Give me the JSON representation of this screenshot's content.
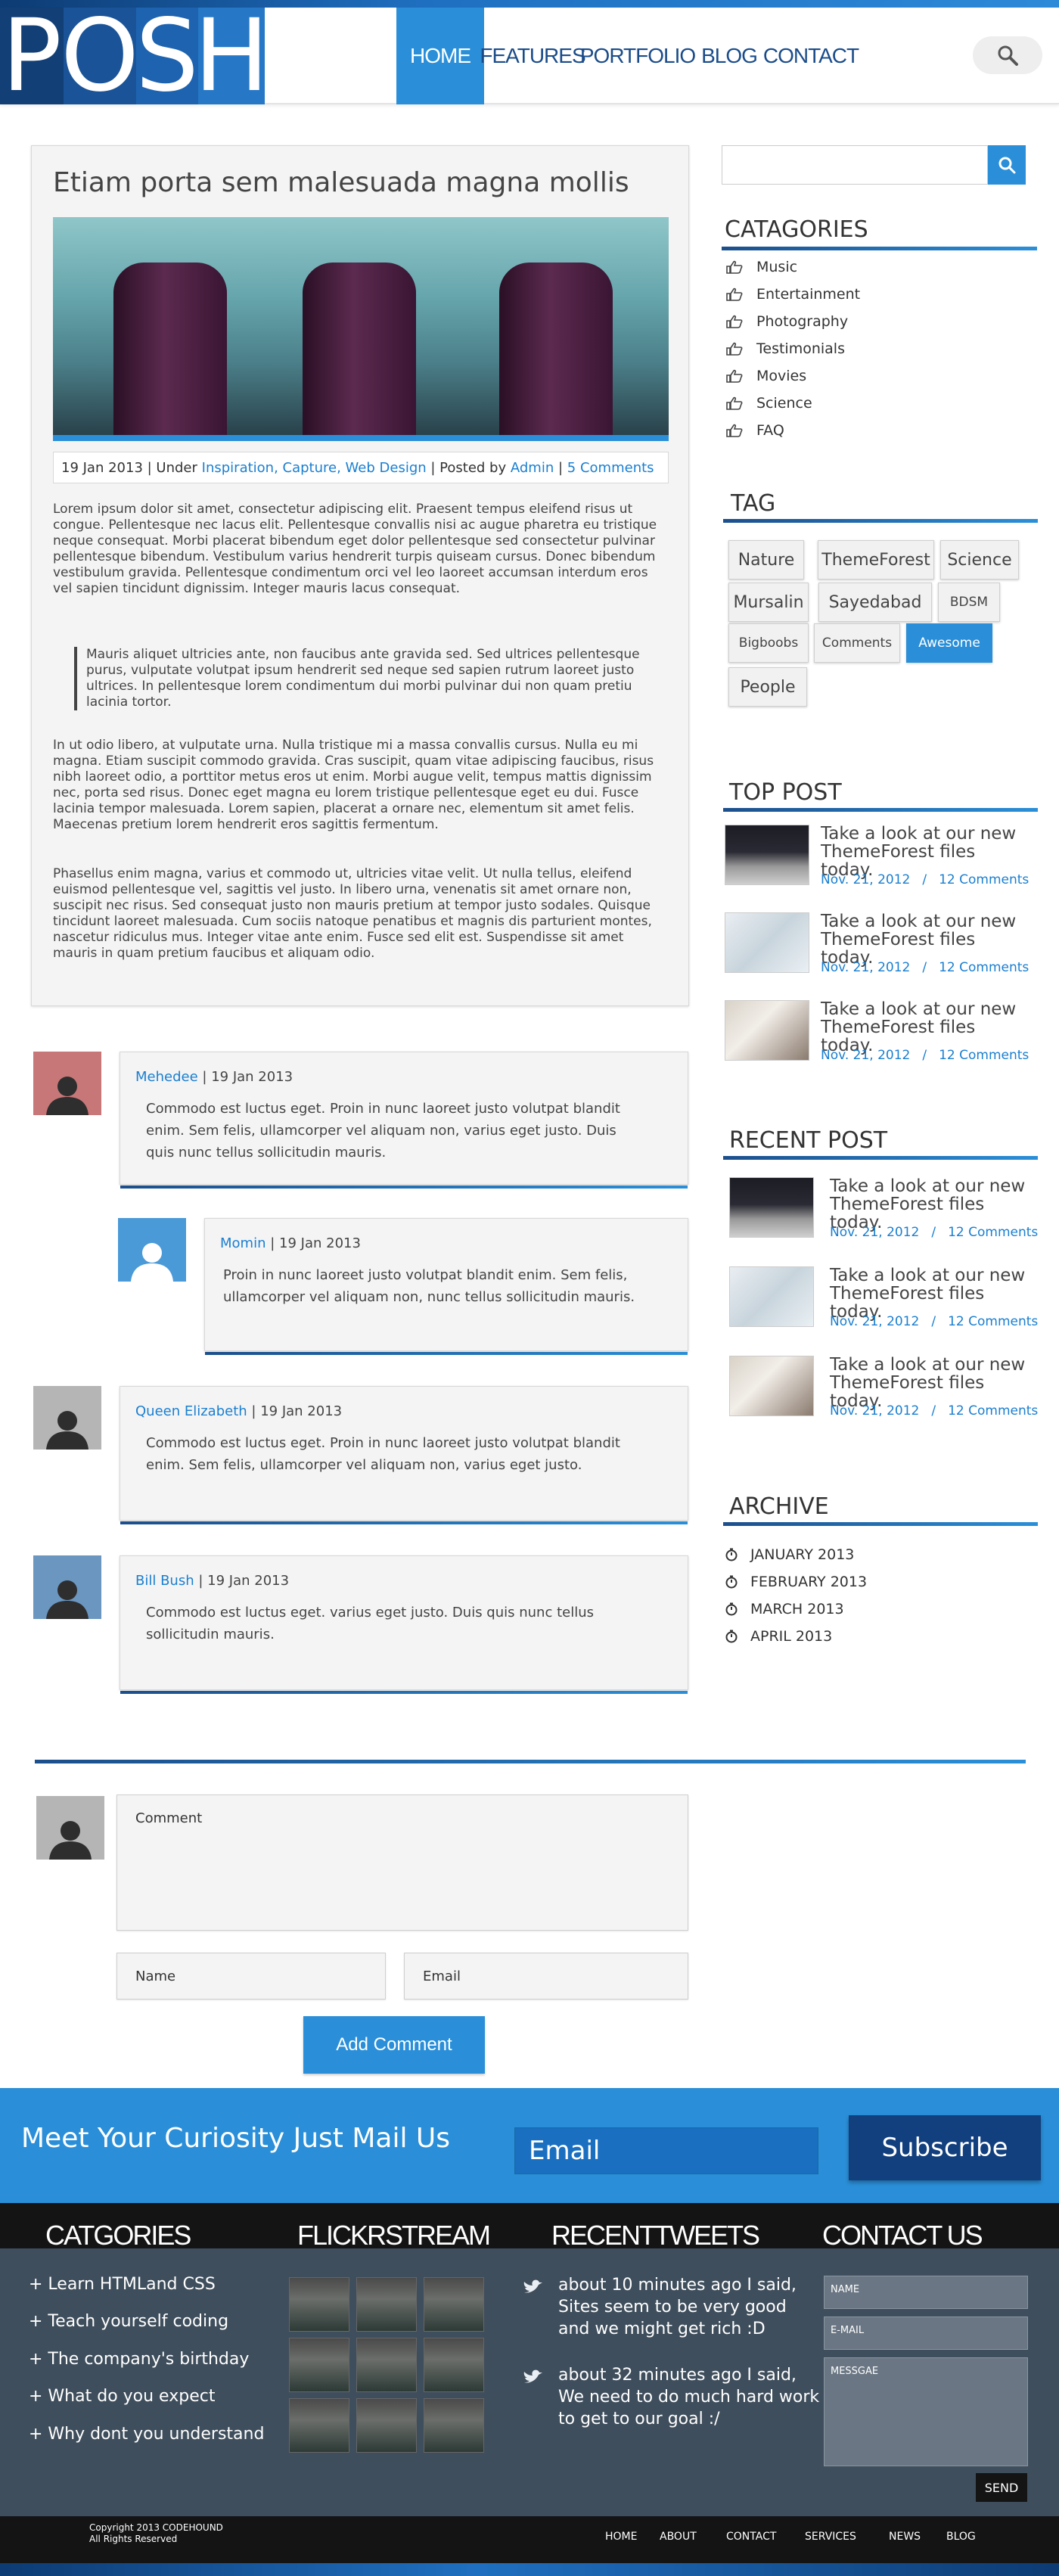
{
  "logo": {
    "letters": [
      "P",
      "O",
      "S",
      "H"
    ]
  },
  "nav": {
    "items": [
      "HOME",
      "FEATURES",
      "PORTFOLIO",
      "BLOG",
      "CONTACT"
    ],
    "active": "HOME"
  },
  "icons": {
    "search": "search-icon",
    "category": "thumbs-up-icon",
    "archive": "clock-icon",
    "tweet": "bird-icon",
    "avatar": "person-icon"
  },
  "colors": {
    "accent": "#2a8fd8",
    "dark_blue": "#123f7d",
    "footer": "#3f4e5c"
  },
  "article": {
    "title": "Etiam porta sem malesuada magna mollis",
    "meta": {
      "date": "19 Jan 2013",
      "under_label": "| Under",
      "categories": "Inspiration, Capture, Web Design",
      "posted_label": "| Posted by",
      "author": "Admin",
      "sep": "|",
      "comments": "5 Comments"
    },
    "p1": "Lorem ipsum dolor sit amet, consectetur adipiscing elit. Praesent tempus eleifend risus ut congue. Pellentesque nec lacus elit. Pellentesque convallis nisi ac augue pharetra eu tristique neque consequat. Morbi placerat bibendum eget dolor pellentesque sed consectetur pulvinar pellentesque bibendum. Vestibulum varius hendrerit turpis quiseam cursus. Donec bibendum vestibulum gravida. Pellentesque condimentum orci vel leo laoreet accumsan interdum eros vel sapien tincidunt dignissim. Integer mauris lacus consequat.",
    "quote": "Mauris aliquet ultricies ante, non faucibus ante gravida sed. Sed ultrices pellentesque purus, vulputate volutpat ipsum hendrerit sed neque sed sapien rutrum laoreet justo ultrices. In pellentesque lorem condimentum dui morbi pulvinar dui non quam pretiu lacinia tortor.",
    "p2": "In ut odio libero, at vulputate urna. Nulla tristique mi a massa convallis cursus. Nulla eu mi magna. Etiam suscipit commodo gravida. Cras suscipit, quam vitae adipiscing faucibus, risus nibh laoreet odio, a porttitor metus eros ut enim. Morbi augue velit, tempus mattis dignissim nec, porta sed risus. Donec eget magna eu lorem tristique pellentesque eget eu dui. Fusce lacinia tempor malesuada. Lorem sapien, placerat a ornare nec, elementum sit amet felis. Maecenas pretium lorem hendrerit eros sagittis fermentum.",
    "p3": "Phasellus enim magna, varius et commodo ut, ultricies vitae velit. Ut nulla tellus, eleifend euismod pellentesque vel, sagittis vel justo. In libero urna, venenatis sit amet ornare non, suscipit nec risus. Sed consequat justo non mauris pretium at tempor justo sodales. Quisque tincidunt laoreet malesuada. Cum sociis natoque penatibus et magnis dis parturient montes, nascetur ridiculus mus. Integer vitae ante enim. Fusce sed elit est. Suspendisse sit amet mauris in quam pretium faucibus et aliquam odio."
  },
  "comments": [
    {
      "name": "Mehedee",
      "date": "| 19 Jan 2013",
      "lines": [
        "Commodo est luctus eget. Proin in nunc laoreet justo volutpat blandit",
        "enim. Sem felis, ullamcorper vel aliquam non, varius eget justo. Duis",
        "quis nunc tellus sollicitudin mauris."
      ],
      "avatar_color": "#c87778"
    },
    {
      "name": "Momin",
      "date": "| 19 Jan 2013",
      "lines": [
        "Proin in nunc laoreet justo volutpat blandit enim. Sem felis,",
        "ullamcorper vel aliquam non, nunc tellus sollicitudin mauris."
      ],
      "avatar_color": "#4a9ad8"
    },
    {
      "name": "Queen Elizabeth",
      "date": "| 19 Jan 2013",
      "lines": [
        "Commodo est luctus eget. Proin in nunc laoreet justo volutpat blandit",
        "enim. Sem felis, ullamcorper vel aliquam non, varius eget justo."
      ],
      "avatar_color": "#b5b5b5"
    },
    {
      "name": "Bill Bush",
      "date": "| 19 Jan 2013",
      "lines": [
        "Commodo est luctus eget. varius eget justo. Duis quis nunc tellus",
        "sollicitudin mauris."
      ],
      "avatar_color": "#6b96c0"
    }
  ],
  "comment_form": {
    "comment_placeholder": "Comment",
    "name_placeholder": "Name",
    "email_placeholder": "Email",
    "submit_label": "Add Comment"
  },
  "sidebar": {
    "categories_title": "CATAGORIES",
    "categories": [
      "Music",
      "Entertainment",
      "Photography",
      "Testimonials",
      "Movies",
      "Science",
      "FAQ"
    ],
    "tag_title": "TAG",
    "tags": [
      "Nature",
      "ThemeForest",
      "Science",
      "Mursalin",
      "Sayedabad",
      "BDSM",
      "Bigboobs",
      "Comments",
      "Awesome",
      "People"
    ],
    "active_tag": "Awesome",
    "top_post_title": "TOP POST",
    "recent_post_title": "RECENT POST",
    "post_title": "Take a look at our new ThemeForest files today.",
    "post_date": "Nov. 21, 2012",
    "post_sep": "/",
    "post_comments": "12 Comments",
    "archive_title": "ARCHIVE",
    "archive": [
      "JANUARY 2013",
      "FEBRUARY 2013",
      "MARCH 2013",
      "APRIL 2013"
    ]
  },
  "newsletter": {
    "title": "Meet Your Curiosity Just Mail Us",
    "email_placeholder": "Email",
    "button": "Subscribe"
  },
  "footer": {
    "titles": [
      "CATGORIES",
      "FLICKRSTREAM",
      "RECENTTWEETS",
      "CONTACT US"
    ],
    "links": [
      "+ Learn HTMLand CSS",
      "+ Teach yourself coding",
      "+ The company's birthday",
      "+ What do you expect",
      "+ Why dont you understand"
    ],
    "tweets": [
      [
        "about 10 minutes ago I said,",
        "Sites seem to be very good",
        "and we might get rich :D"
      ],
      [
        "about 32 minutes ago I said,",
        "We need to do much hard work",
        "to get to our goal :/"
      ]
    ],
    "contact": {
      "name": "NAME",
      "email": "E-MAIL",
      "message": "MESSGAE",
      "send": "SEND"
    },
    "copyright": [
      "Copyright 2013 CODEHOUND",
      "All Rights Reserved"
    ],
    "bottom_nav": [
      "HOME",
      "ABOUT",
      "CONTACT",
      "SERVICES",
      "NEWS",
      "BLOG"
    ]
  }
}
